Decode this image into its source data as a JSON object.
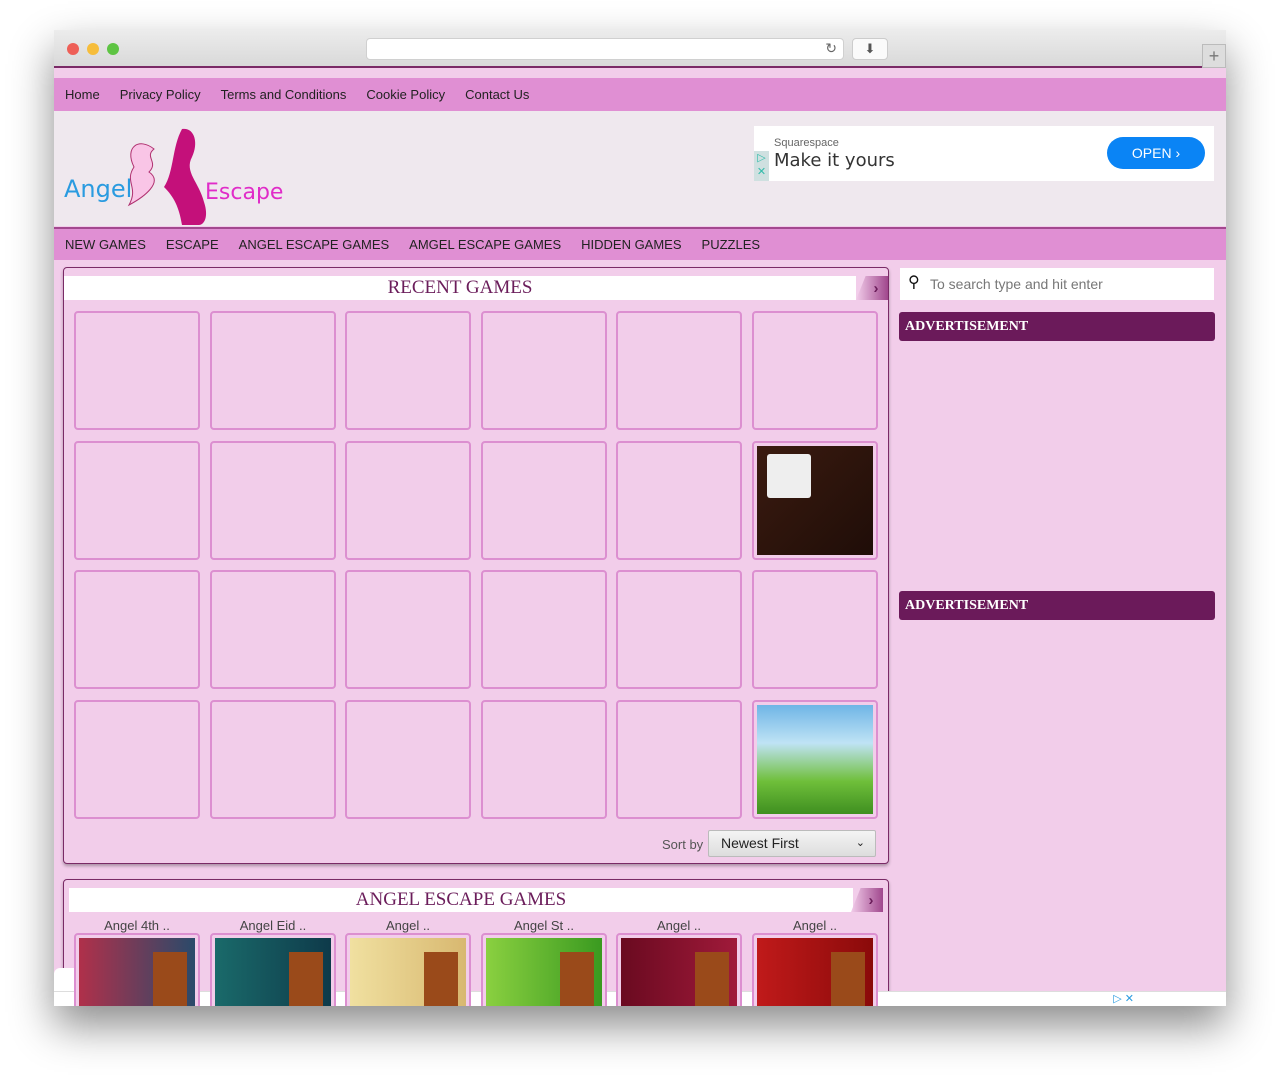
{
  "top_nav": [
    "Home",
    "Privacy Policy",
    "Terms and Conditions",
    "Cookie Policy",
    "Contact Us"
  ],
  "logo": {
    "word1": "Angel",
    "word2": "Escape"
  },
  "ad": {
    "brand": "Squarespace",
    "headline": "Make it yours",
    "button": "OPEN"
  },
  "cat_nav": [
    "NEW GAMES",
    "ESCAPE",
    "ANGEL ESCAPE GAMES",
    "AMGEL ESCAPE GAMES",
    "HIDDEN GAMES",
    "PUZZLES"
  ],
  "recent": {
    "title": "RECENT GAMES",
    "sort_label": "Sort by",
    "sort_value": "Newest First"
  },
  "search": {
    "placeholder": "To search type and hit enter"
  },
  "sidebar": {
    "ad1": "ADVERTISEMENT",
    "ad2": "ADVERTISEMENT"
  },
  "angel": {
    "title": "ANGEL ESCAPE GAMES",
    "items": [
      "Angel 4th ..",
      "Angel Eid ..",
      "Angel ..",
      "Angel St ..",
      "Angel ..",
      "Angel .."
    ]
  },
  "colors": {
    "nav": "#e08fd3",
    "accent": "#6b1a5a",
    "bg": "#f2cdea"
  }
}
